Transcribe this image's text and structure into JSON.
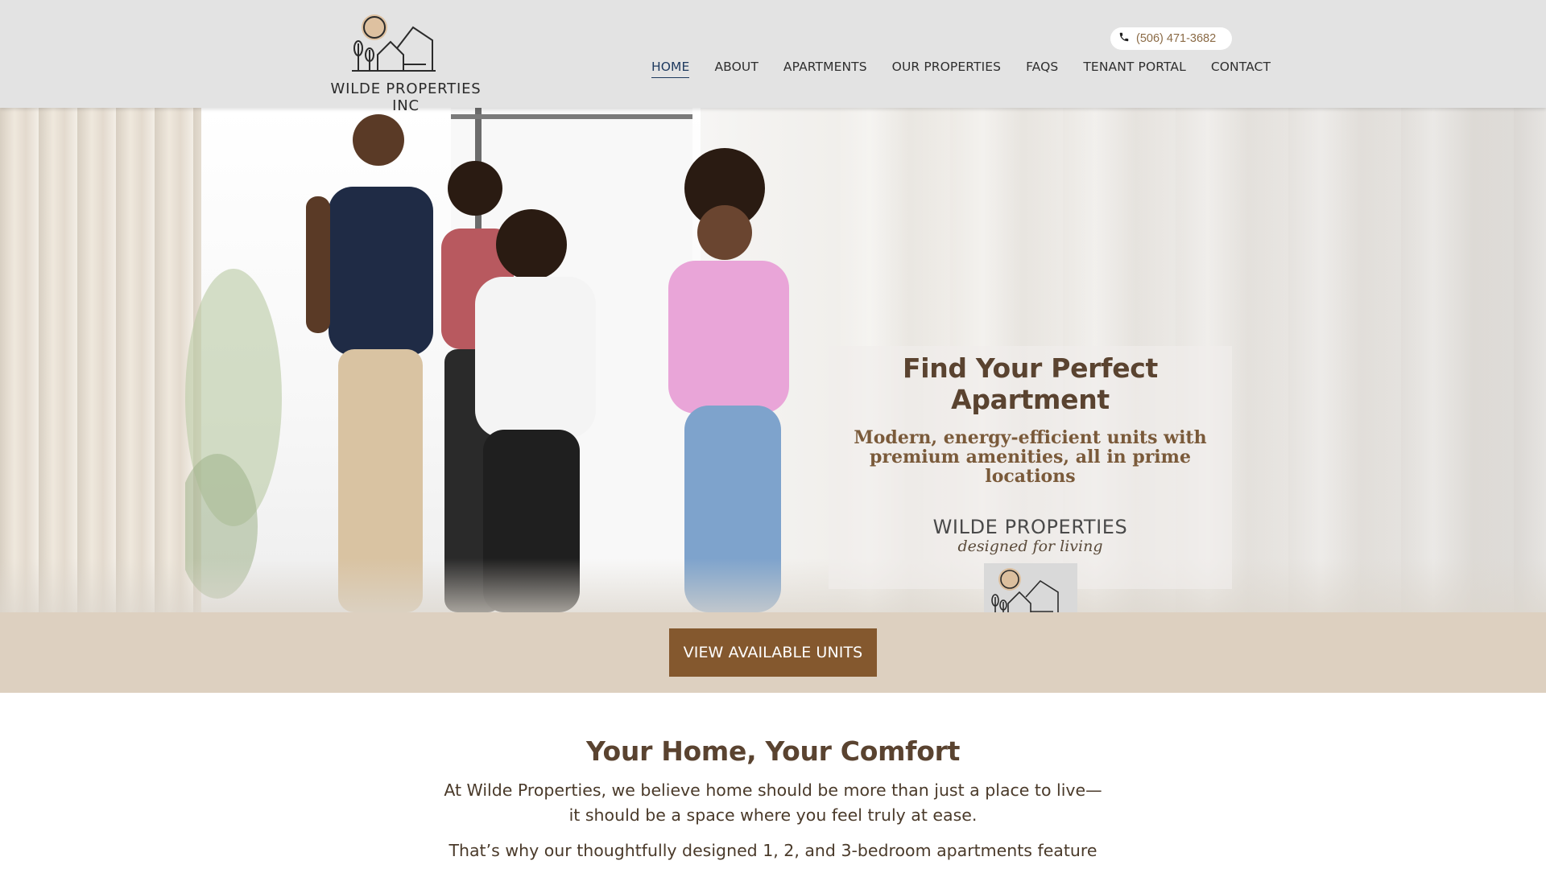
{
  "header": {
    "brand": "WILDE PROPERTIES INC",
    "phone": "(506) 471-3682",
    "nav": [
      {
        "label": "HOME",
        "active": true
      },
      {
        "label": "ABOUT",
        "active": false
      },
      {
        "label": "APARTMENTS",
        "active": false
      },
      {
        "label": "OUR PROPERTIES",
        "active": false
      },
      {
        "label": "FAQS",
        "active": false
      },
      {
        "label": "TENANT PORTAL",
        "active": false
      },
      {
        "label": "CONTACT",
        "active": false
      }
    ]
  },
  "hero": {
    "title": "Find Your Perfect Apartment",
    "subtitle_line1": "Modern, energy-efficient units with",
    "subtitle_line2": "premium amenities, all in prime locations",
    "brand": "WILDE PROPERTIES",
    "tagline": "designed for living",
    "image_alt": "family-running-into-apartment-photo"
  },
  "cta": {
    "label": "VIEW AVAILABLE UNITS"
  },
  "content": {
    "title": "Your Home, Your Comfort",
    "p1_line1": "At Wilde Properties, we believe home should be more than just a place to live—",
    "p1_line2": "it should be a space where you feel truly at ease.",
    "p2_line1": "That’s why our thoughtfully designed 1, 2, and 3-bedroom apartments feature"
  },
  "colors": {
    "brand_brown": "#84582e",
    "heading_brown": "#5a4330",
    "band_beige": "#ddd0c0",
    "sun_accent": "#dcb88e",
    "header_gray": "#e3e3e3"
  },
  "icons": [
    "phone-icon",
    "house-logo-icon",
    "sun-icon",
    "tree-icon"
  ]
}
